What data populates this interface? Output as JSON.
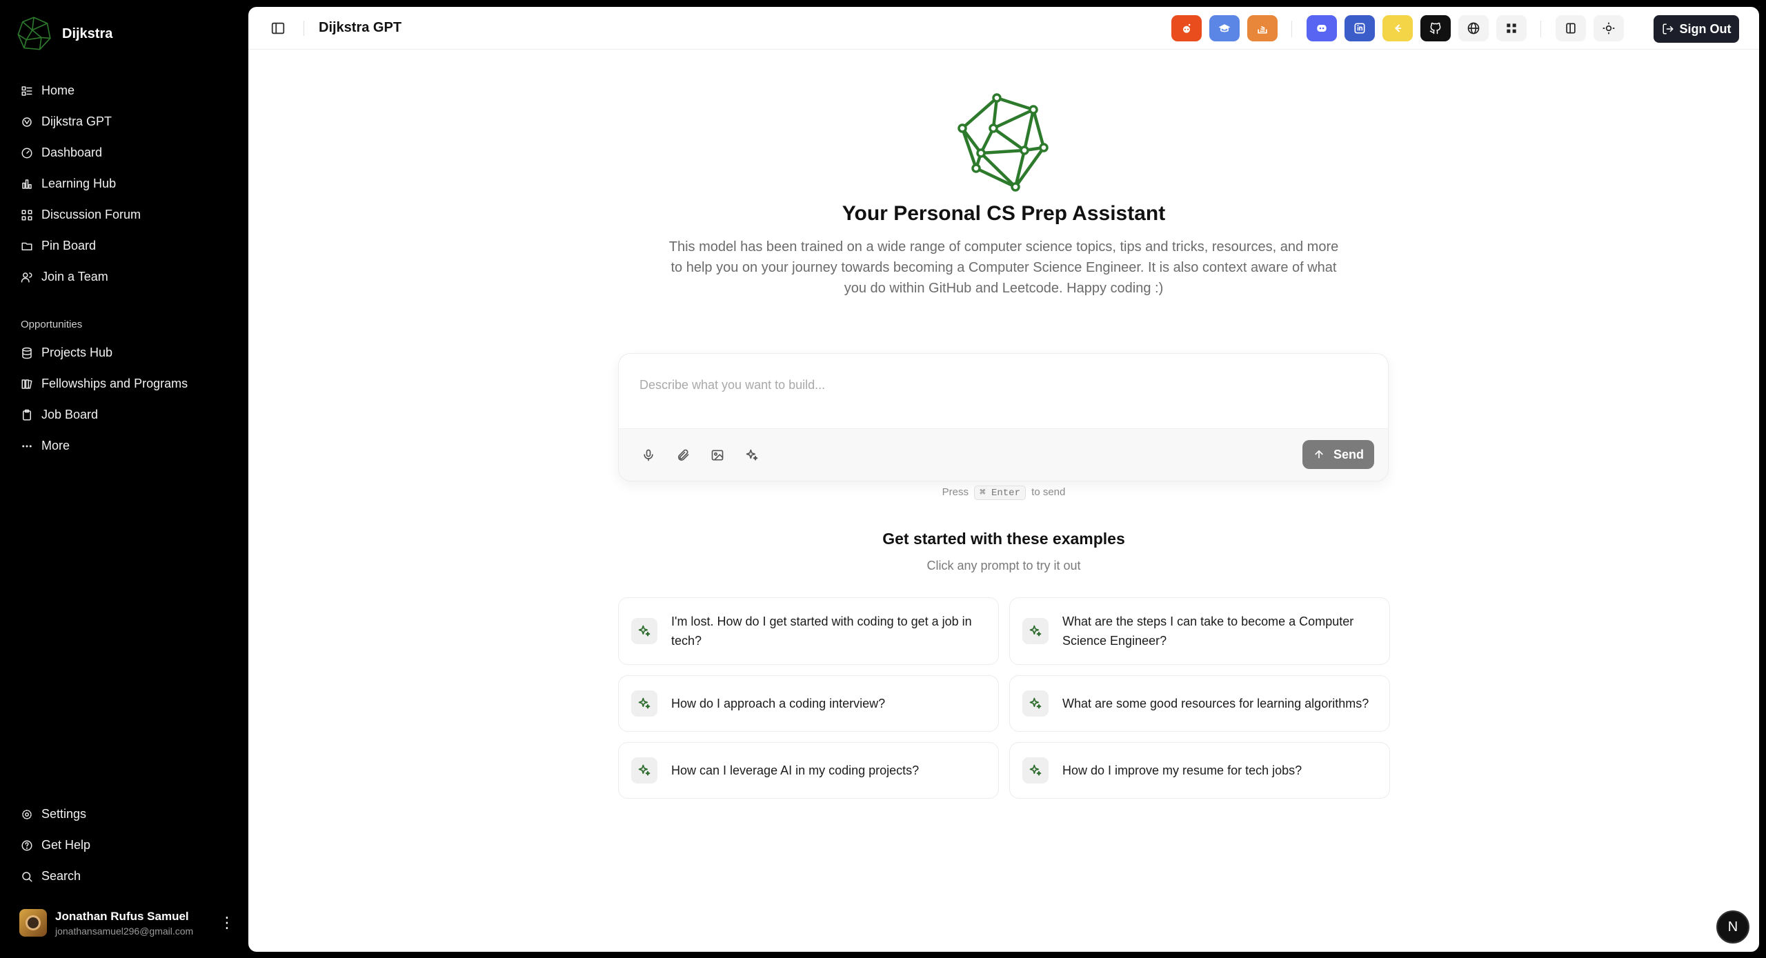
{
  "brand": {
    "name": "Dijkstra"
  },
  "nav": {
    "main": [
      {
        "label": "Home",
        "icon": "home-list-icon"
      },
      {
        "label": "Dijkstra GPT",
        "icon": "gpt-icon"
      },
      {
        "label": "Dashboard",
        "icon": "dashboard-gauge-icon"
      },
      {
        "label": "Learning Hub",
        "icon": "learning-chart-icon"
      },
      {
        "label": "Discussion Forum",
        "icon": "forum-icon"
      },
      {
        "label": "Pin Board",
        "icon": "folder-icon"
      },
      {
        "label": "Join a Team",
        "icon": "users-icon"
      }
    ],
    "section_label": "Opportunities",
    "opportunities": [
      {
        "label": "Projects Hub",
        "icon": "database-icon"
      },
      {
        "label": "Fellowships and Programs",
        "icon": "library-icon"
      },
      {
        "label": "Job Board",
        "icon": "clipboard-icon"
      },
      {
        "label": "More",
        "icon": "more-horizontal-icon"
      }
    ],
    "bottom": [
      {
        "label": "Settings",
        "icon": "settings-icon"
      },
      {
        "label": "Get Help",
        "icon": "help-circle-icon"
      },
      {
        "label": "Search",
        "icon": "search-icon"
      }
    ]
  },
  "user": {
    "name": "Jonathan Rufus Samuel",
    "email": "jonathansamuel296@gmail.com"
  },
  "header": {
    "title": "Dijkstra GPT",
    "sign_out": "Sign Out",
    "icons": [
      {
        "name": "reddit-icon",
        "color": "#ea4d1d"
      },
      {
        "name": "graduation-cap-icon",
        "color": "#5b86e5"
      },
      {
        "name": "stack-overflow-icon",
        "color": "#e8873a"
      },
      {
        "name": "discord-icon",
        "color": "#5865f2"
      },
      {
        "name": "linkedin-icon",
        "color": "#3b5dc9"
      },
      {
        "name": "leetcode-icon",
        "color": "#f5d548"
      },
      {
        "name": "github-icon",
        "color": "#111111"
      },
      {
        "name": "globe-icon",
        "color": "#f3f3f3"
      },
      {
        "name": "apps-grid-icon",
        "color": "#f3f3f3"
      },
      {
        "name": "sidebar-panel-icon",
        "color": "#f3f3f3"
      },
      {
        "name": "sun-icon",
        "color": "#f3f3f3"
      }
    ]
  },
  "hero": {
    "title": "Your Personal CS Prep Assistant",
    "description": "This model has been trained on a wide range of computer science topics, tips and tricks, resources, and more to help you on your journey towards becoming a Computer Science Engineer. It is also context aware of what you do within GitHub and Leetcode. Happy coding :)"
  },
  "composer": {
    "placeholder": "Describe what you want to build...",
    "send_label": "Send",
    "hint_press": "Press",
    "hint_key_cmd": "⌘",
    "hint_key_enter": "Enter",
    "hint_suffix": "to send"
  },
  "examples": {
    "title": "Get started with these examples",
    "subtitle": "Click any prompt to try it out",
    "items": [
      "I'm lost. How do I get started with coding to get a job in tech?",
      "What are the steps I can take to become a Computer Science Engineer?",
      "How do I approach a coding interview?",
      "What are some good resources for learning algorithms?",
      "How can I leverage AI in my coding projects?",
      "How do I improve my resume for tech jobs?"
    ]
  },
  "badge": "N",
  "colors": {
    "accent": "#2d7a2d",
    "send": "#7b7b7b",
    "signout": "#1c1f2a"
  }
}
